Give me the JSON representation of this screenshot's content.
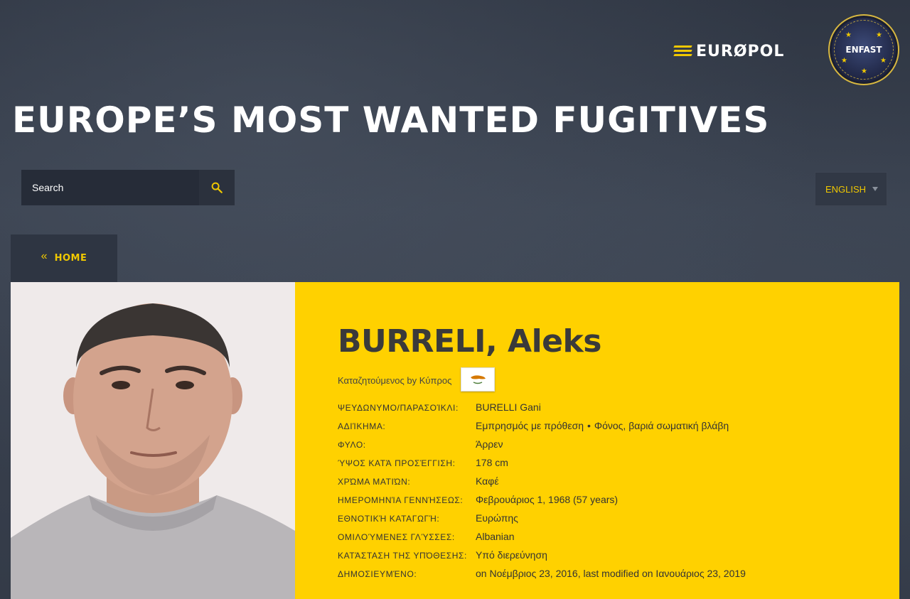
{
  "header": {
    "europol_logo_text": "EURØPOL",
    "enfast_logo_text": "ENFAST",
    "title": "EUROPE’S MOST WANTED FUGITIVES"
  },
  "search": {
    "placeholder": "Search",
    "icon": "search-icon"
  },
  "language": {
    "selected": "ENGLISH",
    "icon": "caret-down-icon"
  },
  "nav": {
    "home_label": "HOME",
    "home_icon": "double-chevron-left-icon"
  },
  "fugitive": {
    "name": "BURRELI, Aleks",
    "wanted_by": "Καταζητούμενος by Κύπρος",
    "flag_icon": "cyprus-flag-icon",
    "details": [
      {
        "label": "ΨΕΥΔΩΝΥΜΟ/ΠΑΡΑΣΟΊΚΛΙ:",
        "value": "BURELLI Gani"
      },
      {
        "label": "ΑΔΙΊΚΗΜΑ:",
        "value": "Εμπρησμός με πρόθεση",
        "value2": "Φόνος, βαριά σωματική βλάβη"
      },
      {
        "label": "ΦΥΛΟ:",
        "value": "Άρρεν"
      },
      {
        "label": "ΎΨΟΣ ΚΑΤΆ ΠΡΟΣΈΓΓΙΣΗ:",
        "value": "178 cm"
      },
      {
        "label": "ΧΡΏΜΑ ΜΑΤΙΏΝ:",
        "value": "Καφέ"
      },
      {
        "label": "ΗΜΕΡΟΜΗΝΊΑ ΓΕΝΝΉΣΕΩΣ:",
        "value": "Φεβρουάριος 1, 1968 (57 years)"
      },
      {
        "label": "ΕΘΝΟΤΙΚΉ ΚΑΤΑΓΩΓΉ:",
        "value": "Ευρώπης"
      },
      {
        "label": "ΟΜΙΛΟΎΜΕΝΕΣ ΓΛΎΣΣΕΣ:",
        "value": "Albanian"
      },
      {
        "label": "ΚΑΤΆΣΤΑΣΗ ΤΗΣ ΥΠΌΘΕΣΗΣ:",
        "value": "Υπό διερεύνηση"
      },
      {
        "label": "ΔΗΜΟΣΙΕΥΜΈΝΟ:",
        "value": "on Νοέμβριος 23, 2016, last modified on Ιανουάριος 23, 2019"
      }
    ]
  }
}
